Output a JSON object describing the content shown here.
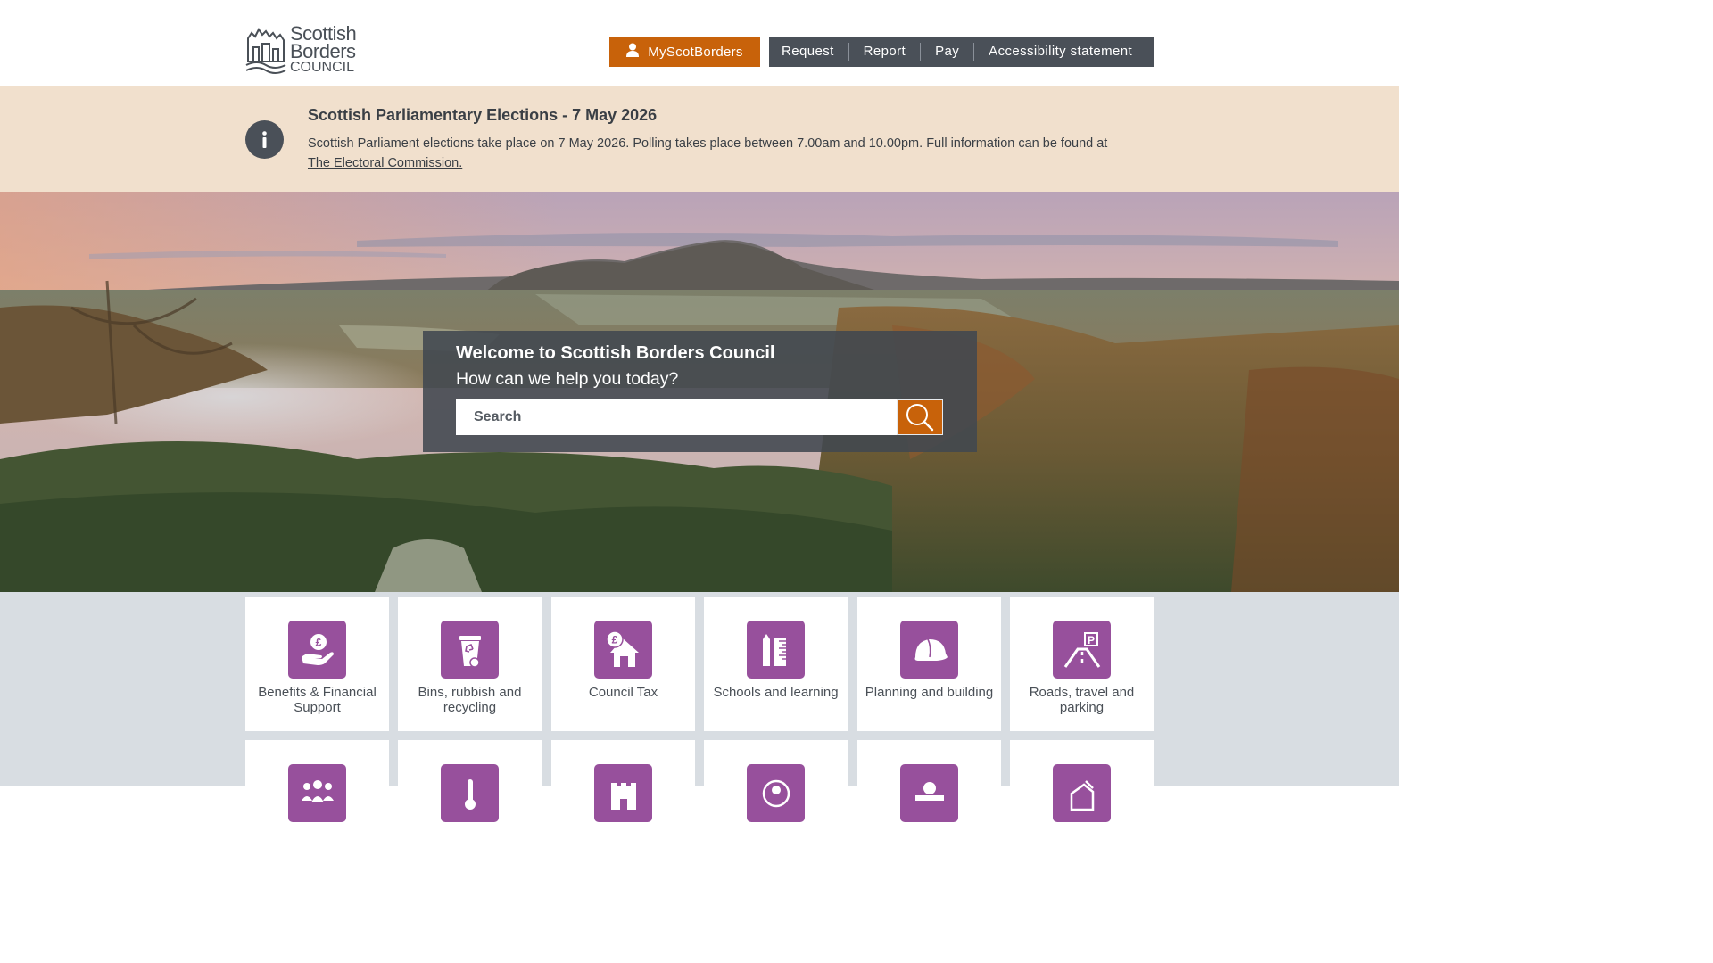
{
  "header": {
    "logo": {
      "line1": "Scottish",
      "line2": "Borders",
      "line3": "COUNCIL"
    },
    "account_button": "MyScotBorders",
    "nav": [
      "Request",
      "Report",
      "Pay",
      "Accessibility statement"
    ]
  },
  "alert": {
    "title": "Scottish Parliamentary Elections - 7 May 2026",
    "body": "Scottish Parliament elections take place on 7 May 2026. Polling takes place between 7.00am and 10.00pm. Full information can be found at",
    "link": "The Electoral Commission."
  },
  "search": {
    "title": "Welcome to Scottish Borders Council",
    "subtitle": "How can we help you today?",
    "placeholder": "Search"
  },
  "tiles": [
    {
      "label": "Benefits & Financial Support",
      "icon": "hand-pound-icon"
    },
    {
      "label": "Bins, rubbish and recycling",
      "icon": "bin-icon"
    },
    {
      "label": "Council Tax",
      "icon": "house-pound-icon"
    },
    {
      "label": "Schools and learning",
      "icon": "pencil-ruler-icon"
    },
    {
      "label": "Planning and building",
      "icon": "hard-hat-icon"
    },
    {
      "label": "Roads, travel and parking",
      "icon": "road-parking-icon"
    }
  ],
  "tiles_row2": [
    {
      "icon": "people-icon"
    },
    {
      "icon": "thermometer-icon"
    },
    {
      "icon": "castle-icon"
    },
    {
      "icon": "location-pin-icon"
    },
    {
      "icon": "person-icon"
    },
    {
      "icon": "building-icon"
    }
  ],
  "colors": {
    "accent_orange": "#c8620a",
    "nav_grey": "#4a5058",
    "alert_bg": "#f1e0cd",
    "tile_purple": "#97509c",
    "tiles_bg": "#d8dde2"
  }
}
